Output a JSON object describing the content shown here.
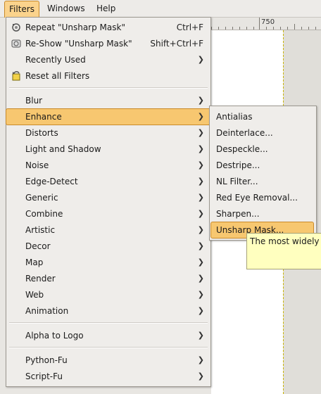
{
  "menubar": {
    "items": [
      "Filters",
      "Windows",
      "Help"
    ]
  },
  "ruler": {
    "label": "750"
  },
  "filters_menu": {
    "items": [
      {
        "label": "Repeat \"Unsharp Mask\"",
        "accel": "Ctrl+F",
        "icon": "repeat-filter-icon"
      },
      {
        "label": "Re-Show \"Unsharp Mask\"",
        "accel": "Shift+Ctrl+F",
        "icon": "reshow-filter-icon"
      },
      {
        "label": "Recently Used",
        "submenu": true
      },
      {
        "label": "Reset all Filters",
        "icon": "reset-filters-icon"
      },
      {
        "label": "Blur",
        "submenu": true
      },
      {
        "label": "Enhance",
        "submenu": true,
        "highlighted": true
      },
      {
        "label": "Distorts",
        "submenu": true
      },
      {
        "label": "Light and Shadow",
        "submenu": true
      },
      {
        "label": "Noise",
        "submenu": true
      },
      {
        "label": "Edge-Detect",
        "submenu": true
      },
      {
        "label": "Generic",
        "submenu": true
      },
      {
        "label": "Combine",
        "submenu": true
      },
      {
        "label": "Artistic",
        "submenu": true
      },
      {
        "label": "Decor",
        "submenu": true
      },
      {
        "label": "Map",
        "submenu": true
      },
      {
        "label": "Render",
        "submenu": true
      },
      {
        "label": "Web",
        "submenu": true
      },
      {
        "label": "Animation",
        "submenu": true
      },
      {
        "label": "Alpha to Logo",
        "submenu": true
      },
      {
        "label": "Python-Fu",
        "submenu": true
      },
      {
        "label": "Script-Fu",
        "submenu": true
      }
    ]
  },
  "enhance_submenu": {
    "items": [
      "Antialias",
      "Deinterlace...",
      "Despeckle...",
      "Destripe...",
      "NL Filter...",
      "Red Eye Removal...",
      "Sharpen...",
      "Unsharp Mask..."
    ],
    "highlighted": "Unsharp Mask..."
  },
  "tooltip": {
    "text": "The most widely"
  },
  "colors": {
    "highlight": "#f7c770",
    "highlight_border": "#c98a2a",
    "menu_bg": "#efedea",
    "tooltip_bg": "#ffffbf"
  }
}
